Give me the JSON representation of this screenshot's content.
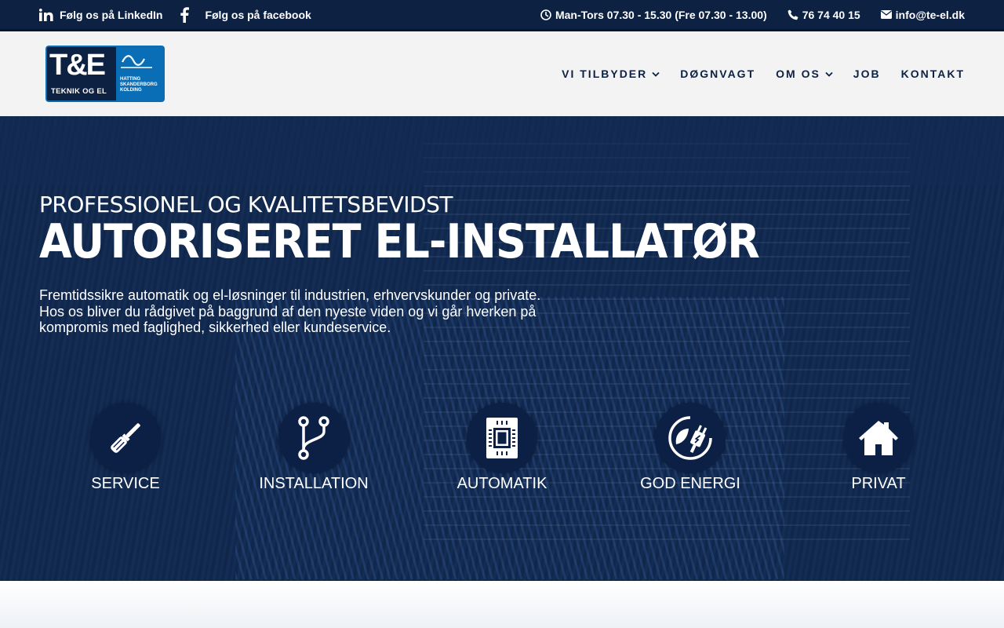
{
  "topbar": {
    "linkedin_label": "Følg os på LinkedIn",
    "facebook_label": "Følg os på facebook",
    "hours": "Man-Tors 07.30 - 15.30 (Fre 07.30 - 13.00)",
    "phone": "76 74 40 15",
    "email": "info@te-el.dk"
  },
  "logo": {
    "main": "T&E",
    "sub": "TEKNIK OG EL",
    "towns_1": "HATTING",
    "towns_2": "SKANDERBORG",
    "towns_3": "KOLDING"
  },
  "nav": {
    "items": [
      {
        "label": "VI TILBYDER",
        "has_dropdown": true
      },
      {
        "label": "DØGNVAGT",
        "has_dropdown": false
      },
      {
        "label": "OM OS",
        "has_dropdown": true
      },
      {
        "label": "JOB",
        "has_dropdown": false
      },
      {
        "label": "KONTAKT",
        "has_dropdown": false
      }
    ]
  },
  "hero": {
    "subtitle": "PROFESSIONEL OG KVALITETSBEVIDST",
    "title": "AUTORISERET EL-INSTALLATØR",
    "lead_1": "Fremtidssikre automatik og el-løsninger til industrien, erhvervskunder og private.",
    "lead_2": "Hos os bliver du rådgivet på baggrund af den nyeste viden og vi går hverken på",
    "lead_3": "kompromis med faglighed, sikkerhed eller kundeservice."
  },
  "services": [
    {
      "label": "SERVICE",
      "icon": "screwdriver-icon"
    },
    {
      "label": "INSTALLATION",
      "icon": "branch-icon"
    },
    {
      "label": "AUTOMATIK",
      "icon": "chip-icon"
    },
    {
      "label": "GOD ENERGI",
      "icon": "eco-plug-icon"
    },
    {
      "label": "PRIVAT",
      "icon": "house-icon"
    }
  ],
  "colors": {
    "navy": "#0d2143",
    "brand_blue": "#0a6eb6",
    "header_bg": "#f3f3f3"
  }
}
